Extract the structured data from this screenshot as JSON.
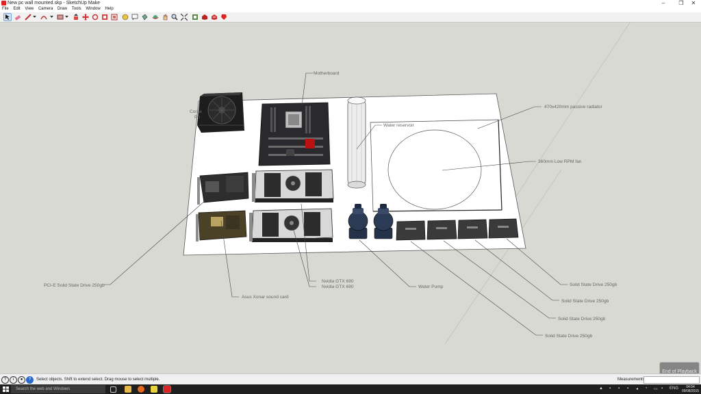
{
  "window": {
    "title": "New pc wall mounted.skp - SketchUp Make",
    "controls": {
      "minimize": "–",
      "maximize": "❐",
      "close": "✕"
    }
  },
  "menu": [
    "File",
    "Edit",
    "View",
    "Camera",
    "Draw",
    "Tools",
    "Window",
    "Help"
  ],
  "toolbar": {
    "tools": [
      "select-icon",
      "eraser-icon",
      "pencil-icon",
      "arc-icon",
      "rectangle-icon",
      "push-pull-icon",
      "move-icon",
      "rotate-icon",
      "scale-icon",
      "offset-icon",
      "tape-measure-icon",
      "text-icon",
      "paint-bucket-icon",
      "orbit-icon",
      "pan-icon",
      "zoom-icon",
      "zoom-extents-icon",
      "warehouse-icon",
      "extension-icon",
      "share-icon",
      "ruby-icon"
    ]
  },
  "labels": {
    "motherboard": "Motherboard",
    "radiator": "470x420mm passive radiator",
    "reservoir": "Water reservoir",
    "fan": "360mm Low RPM fan",
    "psu_line1": "Corsa",
    "psu_line2": "Po",
    "pcie_ssd": "PCI-E Solid State Drive 250gb",
    "sound_card": "Asus Xonar sound card",
    "gpu1": "Nvidia GTX 690",
    "gpu2": "Nvidia GTX 690",
    "pump": "Water Pump",
    "ssd1": "Solid State Drive 250gb",
    "ssd2": "Solid State Drive 250gb",
    "ssd3": "Solid State Drive 250gb",
    "ssd4": "Solid State Drive 250gb"
  },
  "status": {
    "message": "Select objects. Shift to extend select. Drag mouse to select multiple.",
    "measurements_label": "Measurements",
    "measurements_value": ""
  },
  "playback": "End of Playback",
  "taskbar": {
    "search_placeholder": "Search the web and Windows",
    "language": "ENG",
    "time": "04:54",
    "date": "09/08/2015"
  }
}
